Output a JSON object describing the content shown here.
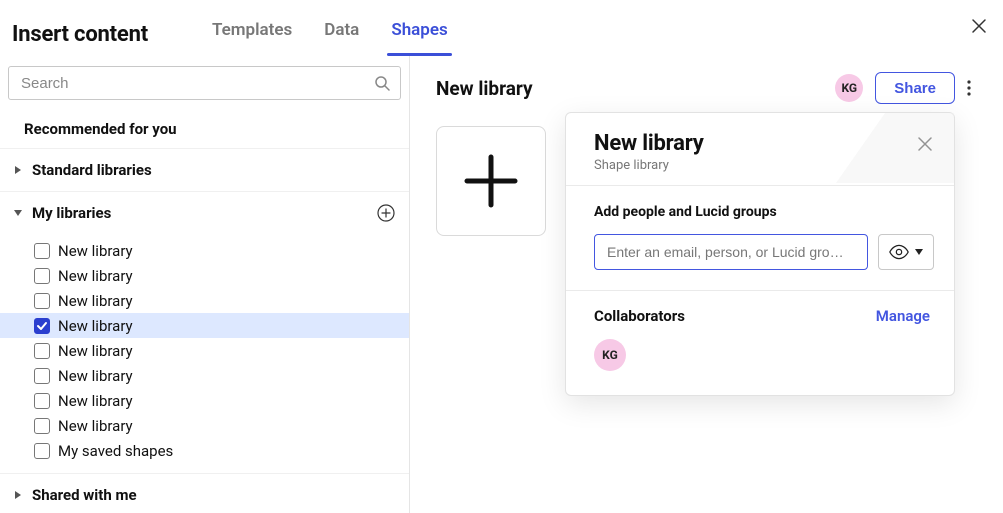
{
  "header": {
    "title": "Insert content",
    "tabs": [
      {
        "label": "Templates",
        "active": false
      },
      {
        "label": "Data",
        "active": false
      },
      {
        "label": "Shapes",
        "active": true
      }
    ]
  },
  "search": {
    "placeholder": "Search",
    "value": ""
  },
  "sidebar": {
    "recommended_label": "Recommended for you",
    "standard_label": "Standard libraries",
    "my_libraries_label": "My libraries",
    "shared_label": "Shared with me",
    "libraries": [
      {
        "label": "New library",
        "checked": false
      },
      {
        "label": "New library",
        "checked": false
      },
      {
        "label": "New library",
        "checked": false
      },
      {
        "label": "New library",
        "checked": true
      },
      {
        "label": "New library",
        "checked": false
      },
      {
        "label": "New library",
        "checked": false
      },
      {
        "label": "New library",
        "checked": false
      },
      {
        "label": "New library",
        "checked": false
      },
      {
        "label": "My saved shapes",
        "checked": false
      }
    ]
  },
  "right": {
    "title": "New library",
    "avatar_initials": "KG",
    "share_label": "Share"
  },
  "popover": {
    "title": "New library",
    "subtitle": "Shape library",
    "add_label": "Add people and Lucid groups",
    "invite_placeholder": "Enter an email, person, or Lucid gro…",
    "collaborators_label": "Collaborators",
    "manage_label": "Manage",
    "collab_avatar_initials": "KG"
  }
}
